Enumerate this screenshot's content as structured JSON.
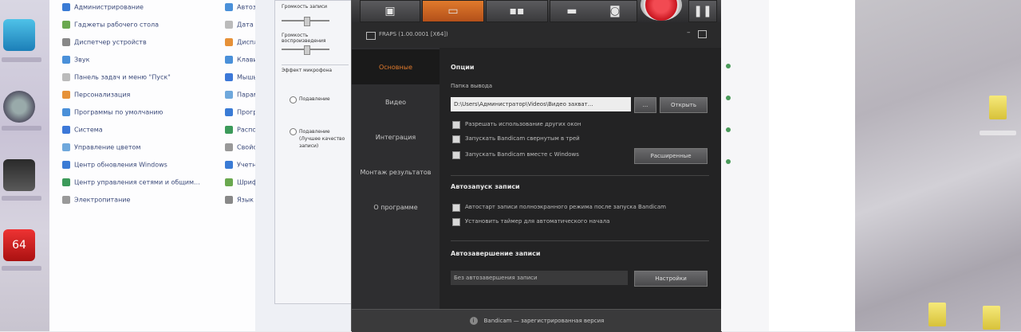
{
  "control_panel": {
    "items": [
      "Администрирование",
      "Гаджеты рабочего стола",
      "Диспетчер устройств",
      "Звук",
      "Панель задач и меню \"Пуск\"",
      "Персонализация",
      "Программы по умолчанию",
      "Система",
      "Управление цветом",
      "Центр обновления Windows",
      "Центр управления сетями и общим...",
      "Электропитание"
    ],
    "right_col": [
      "Автозапуск",
      "Дата и время",
      "Дисплей",
      "Клавиатура",
      "Мышь",
      "Параметры",
      "Программы",
      "Распознавание",
      "Свойства",
      "Учетные",
      "Шрифты",
      "Язык"
    ]
  },
  "behind_dialog": {
    "label1": "Громкость записи",
    "label2": "Громкость воспроизведения",
    "label3": "Эффект микрофона",
    "opt1": "Подавление",
    "opt2": "Подавление (Лучшее качество записи)"
  },
  "app": {
    "title": "FRAPS (1.00.0001 [X64])",
    "tabs": [
      "games",
      "capture",
      "video",
      "folder",
      "camera",
      "record",
      "settings"
    ],
    "sidebar": [
      "Основные",
      "Видео",
      "Интеграция",
      "Монтаж результатов",
      "О программе"
    ],
    "active_sidebar": 0,
    "section_options": "Опции",
    "path_label": "Папка вывода",
    "path_value": "D:\\Users\\Администратор\\Videos\\Видео захват...",
    "browse_label": "...",
    "open_label": "Открыть",
    "checks": [
      "Разрешать использование других окон",
      "Запускать Bandicam свернутым в трей",
      "Запускать Bandicam вместе с Windows"
    ],
    "advanced_btn": "Расширенные",
    "section_autostart": "Автозапуск записи",
    "autostart_checks": [
      "Автостарт записи полноэкранного режима после запуска Bandicam",
      "Установить таймер для автоматического начала"
    ],
    "section_autocomplete": "Автозавершение записи",
    "autocomplete_value": "Без автозавершения записи",
    "autocomplete_btn": "Настройки",
    "footer": "Bandicam — зарегистрированная версия"
  },
  "colors": {
    "accent": "#e07a2c",
    "record": "#d8202a",
    "app_bg": "#1c1c1d"
  }
}
